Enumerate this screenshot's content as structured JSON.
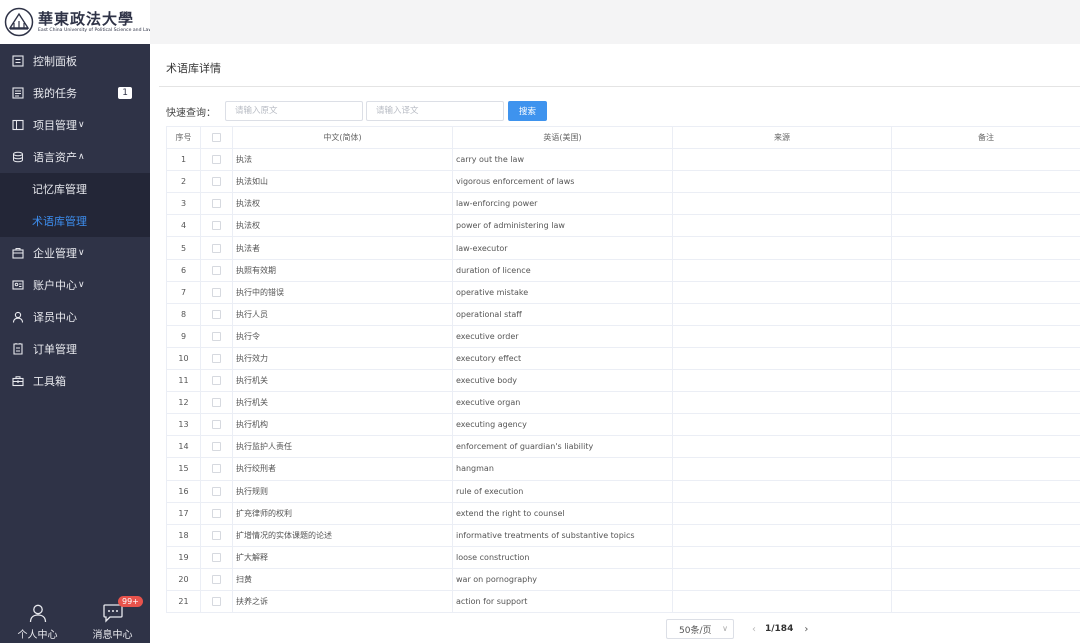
{
  "sidebar": {
    "logo_cn": "華東政法大學",
    "logo_en": "East China University of Political Science and Law",
    "items": [
      {
        "label": "控制面板",
        "icon": "dashboard-icon"
      },
      {
        "label": "我的任务",
        "icon": "task-icon",
        "badge": "1"
      },
      {
        "label": "项目管理",
        "icon": "project-icon",
        "chevron": "∨"
      },
      {
        "label": "语言资产",
        "icon": "stack-icon",
        "chevron": "∧"
      },
      {
        "label": "企业管理",
        "icon": "enterprise-icon",
        "chevron": "∨"
      },
      {
        "label": "账户中心",
        "icon": "account-icon",
        "chevron": "∨"
      },
      {
        "label": "译员中心",
        "icon": "user-icon"
      },
      {
        "label": "订单管理",
        "icon": "order-icon"
      },
      {
        "label": "工具箱",
        "icon": "toolbox-icon"
      }
    ],
    "sub_items": [
      {
        "label": "记忆库管理"
      },
      {
        "label": "术语库管理"
      }
    ],
    "bottom": {
      "personal": "个人中心",
      "messages": "消息中心",
      "message_badge": "99+"
    }
  },
  "page": {
    "title": "术语库详情"
  },
  "search": {
    "label": "快速查询：",
    "source_placeholder": "请输入原文",
    "target_placeholder": "请输入译文",
    "button": "搜索"
  },
  "table": {
    "headers": {
      "index": "序号",
      "chinese": "中文(简体)",
      "english": "英语(美国)",
      "source": "来源",
      "note": "备注"
    },
    "rows": [
      {
        "no": "1",
        "cn": "执法",
        "en": "carry out the law"
      },
      {
        "no": "2",
        "cn": "执法如山",
        "en": "vigorous enforcement of laws"
      },
      {
        "no": "3",
        "cn": "执法权",
        "en": "law-enforcing power"
      },
      {
        "no": "4",
        "cn": "执法权",
        "en": "power of administering law"
      },
      {
        "no": "5",
        "cn": "执法者",
        "en": "law-executor"
      },
      {
        "no": "6",
        "cn": "执照有效期",
        "en": "duration of licence"
      },
      {
        "no": "7",
        "cn": "执行中的错误",
        "en": "operative mistake"
      },
      {
        "no": "8",
        "cn": "执行人员",
        "en": "operational staff"
      },
      {
        "no": "9",
        "cn": "执行令",
        "en": "executive order"
      },
      {
        "no": "10",
        "cn": "执行效力",
        "en": "executory effect"
      },
      {
        "no": "11",
        "cn": "执行机关",
        "en": "executive body"
      },
      {
        "no": "12",
        "cn": "执行机关",
        "en": "executive organ"
      },
      {
        "no": "13",
        "cn": "执行机构",
        "en": "executing agency"
      },
      {
        "no": "14",
        "cn": "执行监护人责任",
        "en": "enforcement of guardian's liability"
      },
      {
        "no": "15",
        "cn": "执行绞刑者",
        "en": "hangman"
      },
      {
        "no": "16",
        "cn": "执行规则",
        "en": "rule of execution"
      },
      {
        "no": "17",
        "cn": "扩充律师的权利",
        "en": "extend the right to counsel"
      },
      {
        "no": "18",
        "cn": "扩增情况的实体课题的论述",
        "en": "informative treatments of substantive topics"
      },
      {
        "no": "19",
        "cn": "扩大解释",
        "en": "loose construction"
      },
      {
        "no": "20",
        "cn": "扫黄",
        "en": "war on pornography"
      },
      {
        "no": "21",
        "cn": "扶养之诉",
        "en": "action for support"
      }
    ]
  },
  "pagination": {
    "page_size": "50条/页",
    "prev": "‹",
    "info": "1/184",
    "next": "›"
  },
  "colors": {
    "sidebar_bg": "#2f3347",
    "accent": "#3e93ee",
    "active_sub": "#3d8eef",
    "badge_red": "#e8534c"
  }
}
